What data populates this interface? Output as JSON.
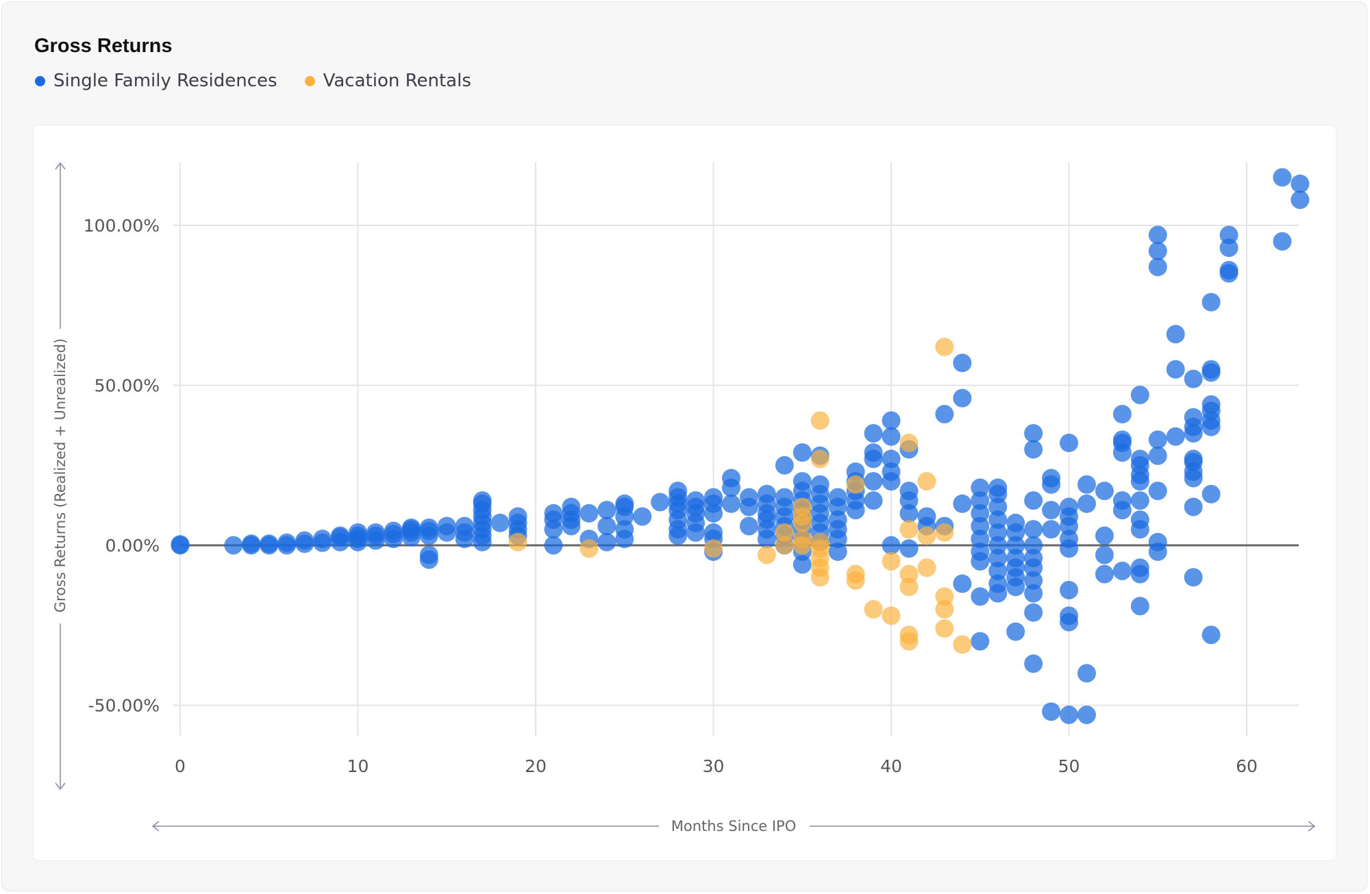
{
  "colors": {
    "sfr": "#1a6be0",
    "vr": "#fbb13c",
    "grid": "#e4e4e8",
    "zero_line": "#666666",
    "axis_arrow": "#8a8aa0"
  },
  "chart_data": {
    "type": "scatter",
    "title": "Gross Returns",
    "xlabel": "Months Since IPO",
    "ylabel": "Gross Returns (Realized + Unrealized)",
    "xlim": [
      0,
      63
    ],
    "ylim": [
      -55,
      115
    ],
    "xticks": [
      0,
      10,
      20,
      30,
      40,
      50,
      60
    ],
    "xtick_labels": [
      "0",
      "10",
      "20",
      "30",
      "40",
      "50",
      "60"
    ],
    "yticks": [
      100,
      50,
      0,
      -50
    ],
    "ytick_labels": [
      "100.00%",
      "50.00%",
      "0.00%",
      "-50.00%"
    ],
    "grid": true,
    "legend_position": "top-left",
    "series": [
      {
        "name": "Single Family Residences",
        "color": "#1a6be0",
        "points": [
          [
            0,
            0
          ],
          [
            0,
            0.3
          ],
          [
            3,
            0
          ],
          [
            4,
            0
          ],
          [
            4,
            0.5
          ],
          [
            5,
            0
          ],
          [
            5,
            0.5
          ],
          [
            6,
            0
          ],
          [
            6,
            0.8
          ],
          [
            7,
            0.5
          ],
          [
            7,
            1.5
          ],
          [
            8,
            0.8
          ],
          [
            8,
            2
          ],
          [
            9,
            1
          ],
          [
            9,
            2.5
          ],
          [
            9,
            3
          ],
          [
            10,
            1
          ],
          [
            10,
            2
          ],
          [
            10,
            3
          ],
          [
            10,
            4
          ],
          [
            11,
            1.5
          ],
          [
            11,
            3
          ],
          [
            11,
            4
          ],
          [
            12,
            2
          ],
          [
            12,
            3.5
          ],
          [
            12,
            4.5
          ],
          [
            13,
            2.5
          ],
          [
            13,
            4
          ],
          [
            13,
            5
          ],
          [
            13,
            5.5
          ],
          [
            14,
            3
          ],
          [
            14,
            4.5
          ],
          [
            14,
            5.5
          ],
          [
            14,
            -3
          ],
          [
            14,
            -4.5
          ],
          [
            15,
            4
          ],
          [
            15,
            6
          ],
          [
            16,
            2
          ],
          [
            16,
            4
          ],
          [
            16,
            6
          ],
          [
            17,
            1
          ],
          [
            17,
            3
          ],
          [
            17,
            5
          ],
          [
            17,
            7
          ],
          [
            17,
            9
          ],
          [
            17,
            11
          ],
          [
            17,
            13
          ],
          [
            17,
            14
          ],
          [
            18,
            7
          ],
          [
            19,
            3
          ],
          [
            19,
            5
          ],
          [
            19,
            7
          ],
          [
            19,
            9
          ],
          [
            21,
            0
          ],
          [
            21,
            5
          ],
          [
            21,
            8
          ],
          [
            21,
            10
          ],
          [
            22,
            6
          ],
          [
            22,
            8
          ],
          [
            22,
            10
          ],
          [
            22,
            12
          ],
          [
            23,
            2
          ],
          [
            23,
            10
          ],
          [
            24,
            1
          ],
          [
            24,
            6
          ],
          [
            24,
            11
          ],
          [
            25,
            2
          ],
          [
            25,
            5
          ],
          [
            25,
            9
          ],
          [
            25,
            12
          ],
          [
            25,
            13
          ],
          [
            26,
            9
          ],
          [
            27,
            13.5
          ],
          [
            28,
            3
          ],
          [
            28,
            5
          ],
          [
            28,
            8
          ],
          [
            28,
            11
          ],
          [
            28,
            13
          ],
          [
            28,
            15
          ],
          [
            28,
            17
          ],
          [
            29,
            4
          ],
          [
            29,
            7
          ],
          [
            29,
            10
          ],
          [
            29,
            12
          ],
          [
            29,
            14
          ],
          [
            30,
            -2
          ],
          [
            30,
            2
          ],
          [
            30,
            4
          ],
          [
            30,
            10
          ],
          [
            30,
            13
          ],
          [
            30,
            15
          ],
          [
            31,
            13
          ],
          [
            31,
            18
          ],
          [
            31,
            21
          ],
          [
            32,
            6
          ],
          [
            32,
            12
          ],
          [
            32,
            15
          ],
          [
            33,
            2
          ],
          [
            33,
            5
          ],
          [
            33,
            8
          ],
          [
            33,
            10
          ],
          [
            33,
            13
          ],
          [
            33,
            16
          ],
          [
            34,
            0
          ],
          [
            34,
            3
          ],
          [
            34,
            6
          ],
          [
            34,
            9
          ],
          [
            34,
            12
          ],
          [
            34,
            15
          ],
          [
            34,
            25
          ],
          [
            35,
            -6
          ],
          [
            35,
            -2
          ],
          [
            35,
            2
          ],
          [
            35,
            5
          ],
          [
            35,
            8
          ],
          [
            35,
            11
          ],
          [
            35,
            14
          ],
          [
            35,
            17
          ],
          [
            35,
            20
          ],
          [
            35,
            29
          ],
          [
            36,
            1
          ],
          [
            36,
            4
          ],
          [
            36,
            7
          ],
          [
            36,
            10
          ],
          [
            36,
            13
          ],
          [
            36,
            16
          ],
          [
            36,
            19
          ],
          [
            36,
            28
          ],
          [
            37,
            -2
          ],
          [
            37,
            2
          ],
          [
            37,
            5
          ],
          [
            37,
            8
          ],
          [
            37,
            12
          ],
          [
            37,
            15
          ],
          [
            38,
            11
          ],
          [
            38,
            14
          ],
          [
            38,
            17
          ],
          [
            38,
            20
          ],
          [
            38,
            23
          ],
          [
            39,
            14
          ],
          [
            39,
            20
          ],
          [
            39,
            27
          ],
          [
            39,
            29
          ],
          [
            39,
            35
          ],
          [
            40,
            0
          ],
          [
            40,
            20
          ],
          [
            40,
            23
          ],
          [
            40,
            27
          ],
          [
            40,
            34
          ],
          [
            40,
            39
          ],
          [
            41,
            -1
          ],
          [
            41,
            10
          ],
          [
            41,
            14
          ],
          [
            41,
            17
          ],
          [
            41,
            30
          ],
          [
            42,
            6
          ],
          [
            42,
            9
          ],
          [
            43,
            6
          ],
          [
            43,
            41
          ],
          [
            44,
            -12
          ],
          [
            44,
            13
          ],
          [
            44,
            46
          ],
          [
            44,
            57
          ],
          [
            45,
            -30
          ],
          [
            45,
            -16
          ],
          [
            45,
            -5
          ],
          [
            45,
            -2
          ],
          [
            45,
            2
          ],
          [
            45,
            6
          ],
          [
            45,
            10
          ],
          [
            45,
            14
          ],
          [
            45,
            18
          ],
          [
            46,
            -15
          ],
          [
            46,
            -12
          ],
          [
            46,
            -8
          ],
          [
            46,
            -4
          ],
          [
            46,
            0
          ],
          [
            46,
            4
          ],
          [
            46,
            8
          ],
          [
            46,
            12
          ],
          [
            46,
            16
          ],
          [
            46,
            18
          ],
          [
            47,
            -27
          ],
          [
            47,
            -13
          ],
          [
            47,
            -10
          ],
          [
            47,
            -7
          ],
          [
            47,
            -4
          ],
          [
            47,
            0
          ],
          [
            47,
            4
          ],
          [
            47,
            7
          ],
          [
            48,
            -37
          ],
          [
            48,
            -21
          ],
          [
            48,
            -15
          ],
          [
            48,
            -11
          ],
          [
            48,
            -7
          ],
          [
            48,
            -4
          ],
          [
            48,
            0
          ],
          [
            48,
            5
          ],
          [
            48,
            14
          ],
          [
            48,
            30
          ],
          [
            48,
            35
          ],
          [
            49,
            -52
          ],
          [
            49,
            5
          ],
          [
            49,
            11
          ],
          [
            49,
            19
          ],
          [
            49,
            21
          ],
          [
            50,
            -53
          ],
          [
            50,
            -24
          ],
          [
            50,
            -22
          ],
          [
            50,
            -14
          ],
          [
            50,
            -1
          ],
          [
            50,
            2
          ],
          [
            50,
            6
          ],
          [
            50,
            9
          ],
          [
            50,
            12
          ],
          [
            50,
            32
          ],
          [
            51,
            -53
          ],
          [
            51,
            -40
          ],
          [
            51,
            13
          ],
          [
            51,
            19
          ],
          [
            52,
            -9
          ],
          [
            52,
            -3
          ],
          [
            52,
            3
          ],
          [
            52,
            17
          ],
          [
            53,
            -8
          ],
          [
            53,
            11
          ],
          [
            53,
            14
          ],
          [
            53,
            29
          ],
          [
            53,
            32
          ],
          [
            53,
            33
          ],
          [
            53,
            41
          ],
          [
            54,
            -19
          ],
          [
            54,
            -9
          ],
          [
            54,
            -7
          ],
          [
            54,
            5
          ],
          [
            54,
            8
          ],
          [
            54,
            14
          ],
          [
            54,
            20
          ],
          [
            54,
            22
          ],
          [
            54,
            25
          ],
          [
            54,
            27
          ],
          [
            54,
            47
          ],
          [
            55,
            -2
          ],
          [
            55,
            1
          ],
          [
            55,
            17
          ],
          [
            55,
            28
          ],
          [
            55,
            33
          ],
          [
            55,
            87
          ],
          [
            55,
            92
          ],
          [
            55,
            97
          ],
          [
            56,
            34
          ],
          [
            56,
            55
          ],
          [
            56,
            66
          ],
          [
            57,
            -10
          ],
          [
            57,
            12
          ],
          [
            57,
            21
          ],
          [
            57,
            23
          ],
          [
            57,
            26
          ],
          [
            57,
            27
          ],
          [
            57,
            35
          ],
          [
            57,
            37
          ],
          [
            57,
            40
          ],
          [
            57,
            52
          ],
          [
            58,
            -28
          ],
          [
            58,
            16
          ],
          [
            58,
            37
          ],
          [
            58,
            39
          ],
          [
            58,
            42
          ],
          [
            58,
            44
          ],
          [
            58,
            54
          ],
          [
            58,
            55
          ],
          [
            58,
            76
          ],
          [
            59,
            85
          ],
          [
            59,
            86
          ],
          [
            59,
            93
          ],
          [
            59,
            97
          ],
          [
            62,
            95
          ],
          [
            62,
            115
          ],
          [
            63,
            108
          ],
          [
            63,
            113
          ]
        ]
      },
      {
        "name": "Vacation Rentals",
        "color": "#fbb13c",
        "points": [
          [
            19,
            1
          ],
          [
            23,
            -1
          ],
          [
            30,
            -1
          ],
          [
            33,
            -3
          ],
          [
            34,
            0
          ],
          [
            34,
            4
          ],
          [
            35,
            0
          ],
          [
            35,
            2
          ],
          [
            35,
            7
          ],
          [
            35,
            9
          ],
          [
            35,
            12
          ],
          [
            36,
            -10
          ],
          [
            36,
            -7
          ],
          [
            36,
            -4
          ],
          [
            36,
            -1
          ],
          [
            36,
            1
          ],
          [
            36,
            27
          ],
          [
            36,
            39
          ],
          [
            38,
            -11
          ],
          [
            38,
            -9
          ],
          [
            38,
            19
          ],
          [
            39,
            -20
          ],
          [
            40,
            -22
          ],
          [
            40,
            -5
          ],
          [
            41,
            -30
          ],
          [
            41,
            -28
          ],
          [
            41,
            -13
          ],
          [
            41,
            -9
          ],
          [
            41,
            5
          ],
          [
            41,
            32
          ],
          [
            42,
            -7
          ],
          [
            42,
            3
          ],
          [
            42,
            20
          ],
          [
            43,
            -26
          ],
          [
            43,
            -20
          ],
          [
            43,
            -16
          ],
          [
            43,
            4
          ],
          [
            43,
            62
          ],
          [
            44,
            -31
          ]
        ]
      }
    ]
  }
}
